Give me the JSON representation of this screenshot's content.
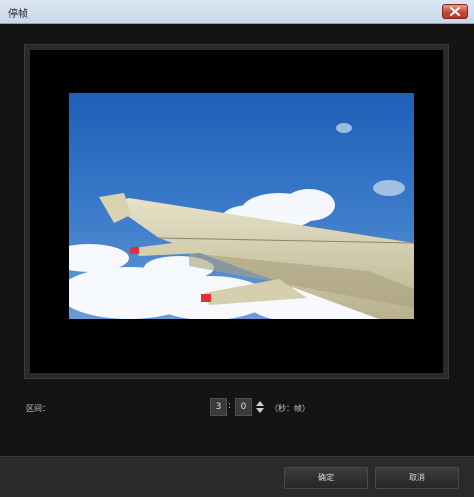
{
  "window": {
    "title": "停帧",
    "close_icon": "close-icon",
    "close_color": "#c44a35"
  },
  "preview": {
    "image_subject": "airplane wing over clouds"
  },
  "duration": {
    "label": "区间：",
    "seconds": "3",
    "separator": ":",
    "frames": "0",
    "unit": "（秒：帧）"
  },
  "buttons": {
    "ok": "确定",
    "cancel": "取消"
  }
}
